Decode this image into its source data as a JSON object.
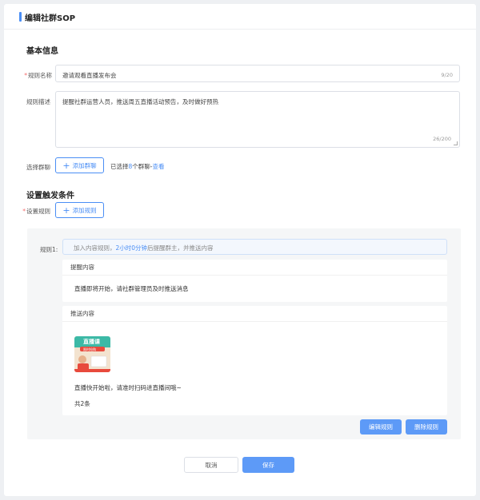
{
  "header": {
    "title": "编辑社群SOP"
  },
  "basic": {
    "section_title": "基本信息",
    "name_label": "规则名称",
    "name_value": "邀请观看直播发布会",
    "name_count": "9/20",
    "desc_label": "规则描述",
    "desc_value": "提醒社群运营人员，推送周五直播活动预告，及时做好预热",
    "desc_count": "26/200",
    "group_label": "选择群聊",
    "add_group_label": "添加群聊",
    "selected_prefix": "已选择",
    "selected_count": "8",
    "selected_suffix": "个群聊-",
    "view_link": "查看"
  },
  "trigger": {
    "section_title": "设置触发条件",
    "rule_label": "设置规则",
    "add_rule_label": "添加规则"
  },
  "rule1": {
    "label": "规则1:",
    "prefix": "加入内容规则，",
    "time": "2小时0分钟",
    "suffix": "后提醒群主，并推送内容",
    "remind_title": "提醒内容",
    "remind_text": "直播即将开始，请社群管理员及时推送消息",
    "push_title": "推送内容",
    "push_text": "直播快开始啦，请准时扫码进直播间哦~",
    "push_total": "共2条",
    "edit_label": "编辑规则",
    "delete_label": "删除规则"
  },
  "thumb": {
    "title": "直播课",
    "tag": "限时抢购"
  },
  "footer": {
    "cancel_label": "取消",
    "save_label": "保存"
  },
  "colors": {
    "accent": "#4a8ef5",
    "required": "#f56c6c",
    "panel_bg": "#f5f6f7"
  }
}
